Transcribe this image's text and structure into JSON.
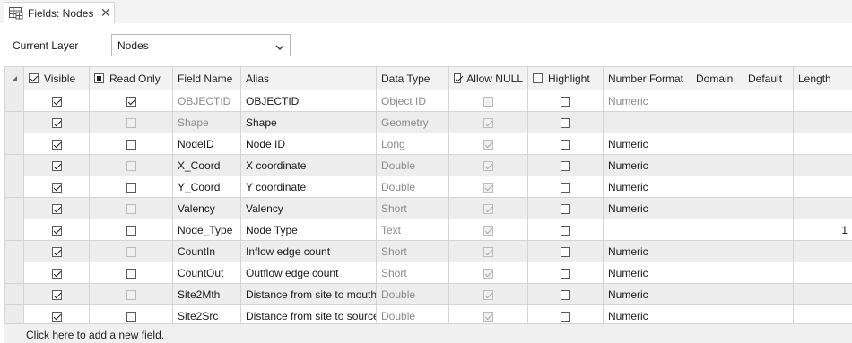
{
  "tab": {
    "label": "Fields: Nodes",
    "icon": "table-grid-icon"
  },
  "current_layer": {
    "label": "Current Layer",
    "value": "Nodes"
  },
  "columns": {
    "visible": "Visible",
    "read_only": "Read Only",
    "field_name": "Field Name",
    "alias": "Alias",
    "data_type": "Data Type",
    "allow_null": "Allow NULL",
    "highlight": "Highlight",
    "number_format": "Number Format",
    "domain": "Domain",
    "default": "Default",
    "length": "Length"
  },
  "header_checks": {
    "visible": true,
    "read_only": "indeterminate",
    "allow_null": true,
    "highlight": false
  },
  "rows": [
    {
      "visible": true,
      "read_only": true,
      "read_only_enabled": true,
      "field_name": "OBJECTID",
      "alias": "OBJECTID",
      "data_type": "Object ID",
      "allow_null": false,
      "highlight": false,
      "number_format": "Numeric",
      "domain": "",
      "default": "",
      "length": "",
      "system": true
    },
    {
      "visible": true,
      "read_only": false,
      "read_only_enabled": false,
      "field_name": "Shape",
      "alias": "Shape",
      "data_type": "Geometry",
      "allow_null": true,
      "highlight": false,
      "number_format": "",
      "domain": "",
      "default": "",
      "length": "",
      "system": true
    },
    {
      "visible": true,
      "read_only": false,
      "read_only_enabled": true,
      "field_name": "NodeID",
      "alias": "Node ID",
      "data_type": "Long",
      "allow_null": true,
      "highlight": false,
      "number_format": "Numeric",
      "domain": "",
      "default": "",
      "length": "",
      "system": false
    },
    {
      "visible": true,
      "read_only": false,
      "read_only_enabled": false,
      "field_name": "X_Coord",
      "alias": "X coordinate",
      "data_type": "Double",
      "allow_null": true,
      "highlight": false,
      "number_format": "Numeric",
      "domain": "",
      "default": "",
      "length": "",
      "system": false
    },
    {
      "visible": true,
      "read_only": false,
      "read_only_enabled": true,
      "field_name": "Y_Coord",
      "alias": "Y coordinate",
      "data_type": "Double",
      "allow_null": true,
      "highlight": false,
      "number_format": "Numeric",
      "domain": "",
      "default": "",
      "length": "",
      "system": false
    },
    {
      "visible": true,
      "read_only": false,
      "read_only_enabled": false,
      "field_name": "Valency",
      "alias": "Valency",
      "data_type": "Short",
      "allow_null": true,
      "highlight": false,
      "number_format": "Numeric",
      "domain": "",
      "default": "",
      "length": "",
      "system": false
    },
    {
      "visible": true,
      "read_only": false,
      "read_only_enabled": true,
      "field_name": "Node_Type",
      "alias": "Node Type",
      "data_type": "Text",
      "allow_null": true,
      "highlight": false,
      "number_format": "",
      "domain": "",
      "default": "",
      "length": "1",
      "system": false
    },
    {
      "visible": true,
      "read_only": false,
      "read_only_enabled": false,
      "field_name": "CountIn",
      "alias": "Inflow edge count",
      "data_type": "Short",
      "allow_null": true,
      "highlight": false,
      "number_format": "Numeric",
      "domain": "",
      "default": "",
      "length": "",
      "system": false
    },
    {
      "visible": true,
      "read_only": false,
      "read_only_enabled": true,
      "field_name": "CountOut",
      "alias": "Outflow edge count",
      "data_type": "Short",
      "allow_null": true,
      "highlight": false,
      "number_format": "Numeric",
      "domain": "",
      "default": "",
      "length": "",
      "system": false
    },
    {
      "visible": true,
      "read_only": false,
      "read_only_enabled": false,
      "field_name": "Site2Mth",
      "alias": "Distance from site to mouth",
      "data_type": "Double",
      "allow_null": true,
      "highlight": false,
      "number_format": "Numeric",
      "domain": "",
      "default": "",
      "length": "",
      "system": false
    },
    {
      "visible": true,
      "read_only": false,
      "read_only_enabled": true,
      "field_name": "Site2Src",
      "alias": "Distance from site to source",
      "data_type": "Double",
      "allow_null": true,
      "highlight": false,
      "number_format": "Numeric",
      "domain": "",
      "default": "",
      "length": "",
      "system": false
    }
  ],
  "add_field_text": "Click here to add a new field."
}
